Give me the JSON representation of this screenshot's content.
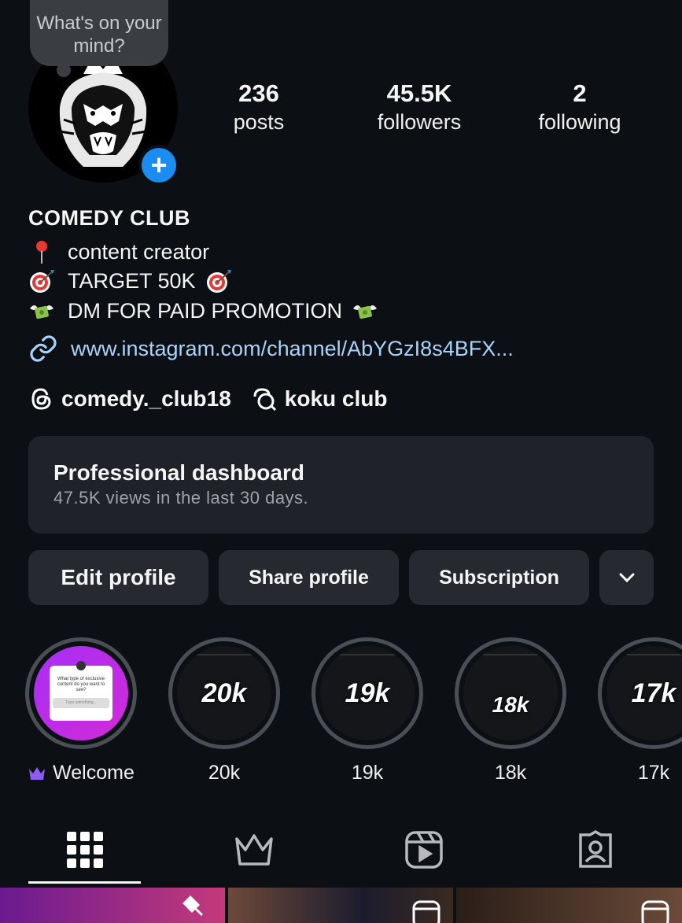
{
  "note": {
    "text": "What's on your mind?"
  },
  "stats": [
    {
      "count": "236",
      "label": "posts"
    },
    {
      "count": "45.5K",
      "label": "followers"
    },
    {
      "count": "2",
      "label": "following"
    }
  ],
  "profile": {
    "name": "COMEDY CLUB",
    "bio": [
      {
        "icon": "round-pushpin-emoji",
        "text": "content creator"
      },
      {
        "icon": "direct-hit-emoji",
        "text": "TARGET 50K"
      },
      {
        "icon": "money-with-wings-emoji",
        "text": "DM FOR PAID PROMOTION"
      }
    ],
    "link": "www.instagram.com/channel/AbYGzI8s4BFX...",
    "threads_handle": "comedy._club18",
    "channel_name": "koku club"
  },
  "dashboard": {
    "title": "Professional dashboard",
    "subtitle": "47.5K views in the last 30 days."
  },
  "buttons": {
    "edit": "Edit profile",
    "share": "Share profile",
    "subscription": "Subscription"
  },
  "highlights": [
    {
      "label": "Welcome",
      "cover_text": "What type of exclusive content do you want to see?",
      "cover_input": "Type something..."
    },
    {
      "label": "20k",
      "cover_num": "20k"
    },
    {
      "label": "19k",
      "cover_num": "19k"
    },
    {
      "label": "18k",
      "cover_num": "18k"
    },
    {
      "label": "17k",
      "cover_num": "17k"
    }
  ],
  "tabs": [
    "grid-icon",
    "crown-icon",
    "reels-icon",
    "tagged-icon"
  ],
  "colors": {
    "accent_blue": "#1a8cf2",
    "link": "#a8d4fb",
    "background": "#0c1014",
    "card": "#1f2329",
    "button": "#262a30",
    "crown": "#8c5cf6"
  }
}
